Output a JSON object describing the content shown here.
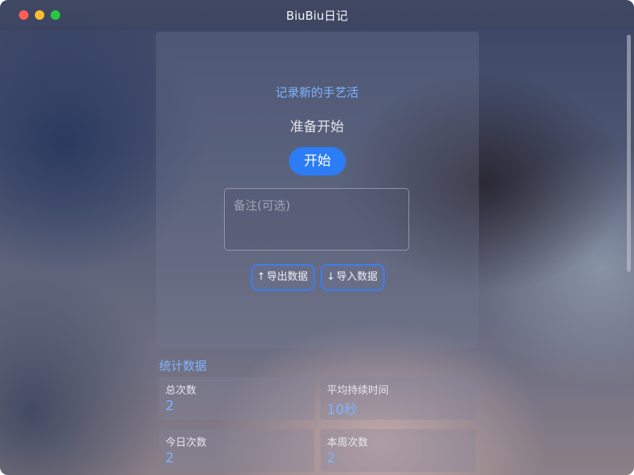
{
  "window": {
    "title": "BiuBiu日记"
  },
  "recorder": {
    "section_title": "记录新的手艺活",
    "status": "准备开始",
    "start_label": "开始",
    "notes_placeholder": "备注(可选)",
    "export_label": "导出数据",
    "import_label": "导入数据",
    "export_icon": "↑",
    "import_icon": "↓"
  },
  "stats": {
    "title": "统计数据",
    "cards": [
      {
        "label": "总次数",
        "value": "2"
      },
      {
        "label": "平均持续时间",
        "value": "10秒"
      },
      {
        "label": "今日次数",
        "value": "2"
      },
      {
        "label": "本周次数",
        "value": "2"
      }
    ]
  },
  "colors": {
    "accent": "#2b7cf5",
    "accent_text": "#7fb3ff",
    "close": "#fe5f57",
    "minimize": "#febc2e",
    "maximize": "#28c840"
  },
  "icons": {
    "export": "arrow-up-icon",
    "import": "arrow-down-icon"
  }
}
